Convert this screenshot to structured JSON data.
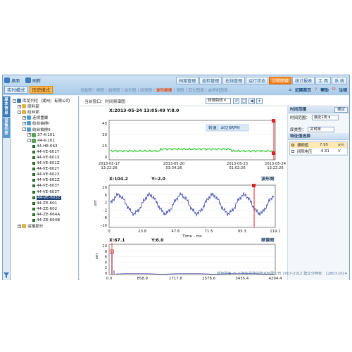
{
  "topnav": [
    {
      "label": "桌面",
      "icon": "desktop-icon"
    },
    {
      "label": "刷新",
      "icon": "refresh-icon"
    }
  ],
  "modes": [
    {
      "label": "实时模式",
      "active": false
    },
    {
      "label": "历史模式",
      "active": true
    }
  ],
  "main_tabs": [
    {
      "label": "档案管理",
      "active": false
    },
    {
      "label": "巡检管理",
      "active": false
    },
    {
      "label": "在线管理",
      "active": false
    },
    {
      "label": "运行状态",
      "active": false
    },
    {
      "label": "诊断图谱",
      "active": true
    },
    {
      "label": "统计报表",
      "active": false
    },
    {
      "label": "工 具",
      "active": false
    },
    {
      "label": "系 统",
      "active": false
    }
  ],
  "subnav": [
    {
      "label": "设备图",
      "active": false
    },
    {
      "label": "棒图",
      "active": false
    },
    {
      "label": "趋势图",
      "active": false
    },
    {
      "label": "波形图",
      "active": false
    },
    {
      "label": "频谱图",
      "active": false
    },
    {
      "label": "波形频谱",
      "active": true
    },
    {
      "label": "谱图",
      "active": false
    },
    {
      "label": "其它图谱",
      "active": false
    },
    {
      "label": "启停机图谱",
      "active": false
    }
  ],
  "topright": {
    "home": "近期首页",
    "help": "帮助",
    "logout": "注销"
  },
  "side_tabs": [
    "基本信息",
    "设备列表"
  ],
  "tree": [
    {
      "label": "库龙列伦（湖州）有限公司",
      "level": 0,
      "exp": "-",
      "kind": "root"
    },
    {
      "label": "原料部",
      "level": 1,
      "exp": "+",
      "kind": "folder"
    },
    {
      "label": "纺丝部",
      "level": 1,
      "exp": "-",
      "kind": "folder"
    },
    {
      "label": "连续重聚",
      "level": 2,
      "exp": "+",
      "kind": "group"
    },
    {
      "label": "纺丝抽排I",
      "level": 2,
      "exp": "+",
      "kind": "group"
    },
    {
      "label": "纺丝抽排II",
      "level": 2,
      "exp": "-",
      "kind": "group"
    },
    {
      "label": "37-K-101",
      "level": 3,
      "exp": "+",
      "kind": "machine"
    },
    {
      "label": "44-K-101",
      "level": 3,
      "exp": "-",
      "kind": "machine"
    },
    {
      "label": "44-HE-663",
      "level": 4,
      "kind": "point"
    },
    {
      "label": "44-VE-601Y",
      "level": 4,
      "kind": "point"
    },
    {
      "label": "44-VE-601X",
      "level": 4,
      "kind": "point"
    },
    {
      "label": "44-VE-601Z",
      "level": 4,
      "kind": "point"
    },
    {
      "label": "44-VE-602Y",
      "level": 4,
      "kind": "point"
    },
    {
      "label": "44-VE-602X",
      "level": 4,
      "kind": "point"
    },
    {
      "label": "44-VE-602Z",
      "level": 4,
      "kind": "point"
    },
    {
      "label": "44-VE-603Y",
      "level": 4,
      "kind": "point"
    },
    {
      "label": "44-VE-603T",
      "level": 4,
      "kind": "point"
    },
    {
      "label": "44-VE-603Z",
      "level": 4,
      "kind": "point",
      "selected": true
    },
    {
      "label": "44-ZE-601",
      "level": 4,
      "kind": "point"
    },
    {
      "label": "44-ZE-602",
      "level": 4,
      "kind": "point"
    },
    {
      "label": "44-ZE-664A",
      "level": 4,
      "kind": "point"
    },
    {
      "label": "44-ZE-664B",
      "level": 4,
      "kind": "point"
    },
    {
      "label": "运输部分",
      "level": 1,
      "exp": "+",
      "kind": "folder"
    }
  ],
  "content": {
    "location": "当前窗口：时间频谱图",
    "view_select": "频谱曲线",
    "tools": [
      "↺",
      "□",
      "◀",
      "+"
    ]
  },
  "trend": {
    "cursor_text": "X:2013-05-24 13:05:49  Y:8.0",
    "speed_label": "转速：4026RPM",
    "y_ticks": [
      "45",
      "30",
      "15",
      "0"
    ],
    "x_ticks": [
      [
        "2013-05-17",
        "13:22:26"
      ],
      [
        "2013-05-20",
        "03:34:26"
      ],
      [
        "2013-05-23",
        "01:02:26"
      ],
      [
        "2013-05-24",
        "13:22:26"
      ]
    ]
  },
  "wave": {
    "cursor_text": "X:104.2",
    "cursor_y": "Y:-2.0",
    "title": "波形图",
    "y_ticks": [
      "10",
      "6",
      "2",
      "-2",
      "-6",
      "-10"
    ],
    "x_ticks": [
      "0",
      "23.8",
      "47.6",
      "71.5",
      "95.3",
      "119.1"
    ],
    "x_label": "Time - ms",
    "y_unit": "um"
  },
  "spectrum": {
    "cursor_text": "X:67.1",
    "cursor_y": "Y:6.0",
    "title": "频谱图",
    "y_ticks": [
      "10",
      "8",
      "6",
      "4",
      "2",
      "0"
    ],
    "x_ticks": [
      "0.0",
      "858.9",
      "1717.8",
      "2576.6",
      "3435.4",
      "4294.4"
    ],
    "x_label": "Hz",
    "y_unit": "um"
  },
  "panel": {
    "time_section": "时间范围",
    "confirm": "确定",
    "range_label": "时间范围：",
    "range_value": "最近1周",
    "type_section": "库类型：",
    "type_value": "实时库",
    "feature_section": "特征值选择",
    "features": [
      {
        "name": "通频值",
        "value": "7.95",
        "unit": "um",
        "checked": true
      },
      {
        "name": "间隙电压",
        "value": "-9.81",
        "unit": "V",
        "checked": false
      }
    ]
  },
  "footer": "版权所有 © 上海东昊测试技术有限公司 2007-2012 建议分辨率：1280×1024",
  "colors": {
    "accent_orange": "#f07a13",
    "trend_green": "#1fc21f",
    "wave_blue": "#1b2b9c",
    "cursor_red": "#e02020"
  }
}
